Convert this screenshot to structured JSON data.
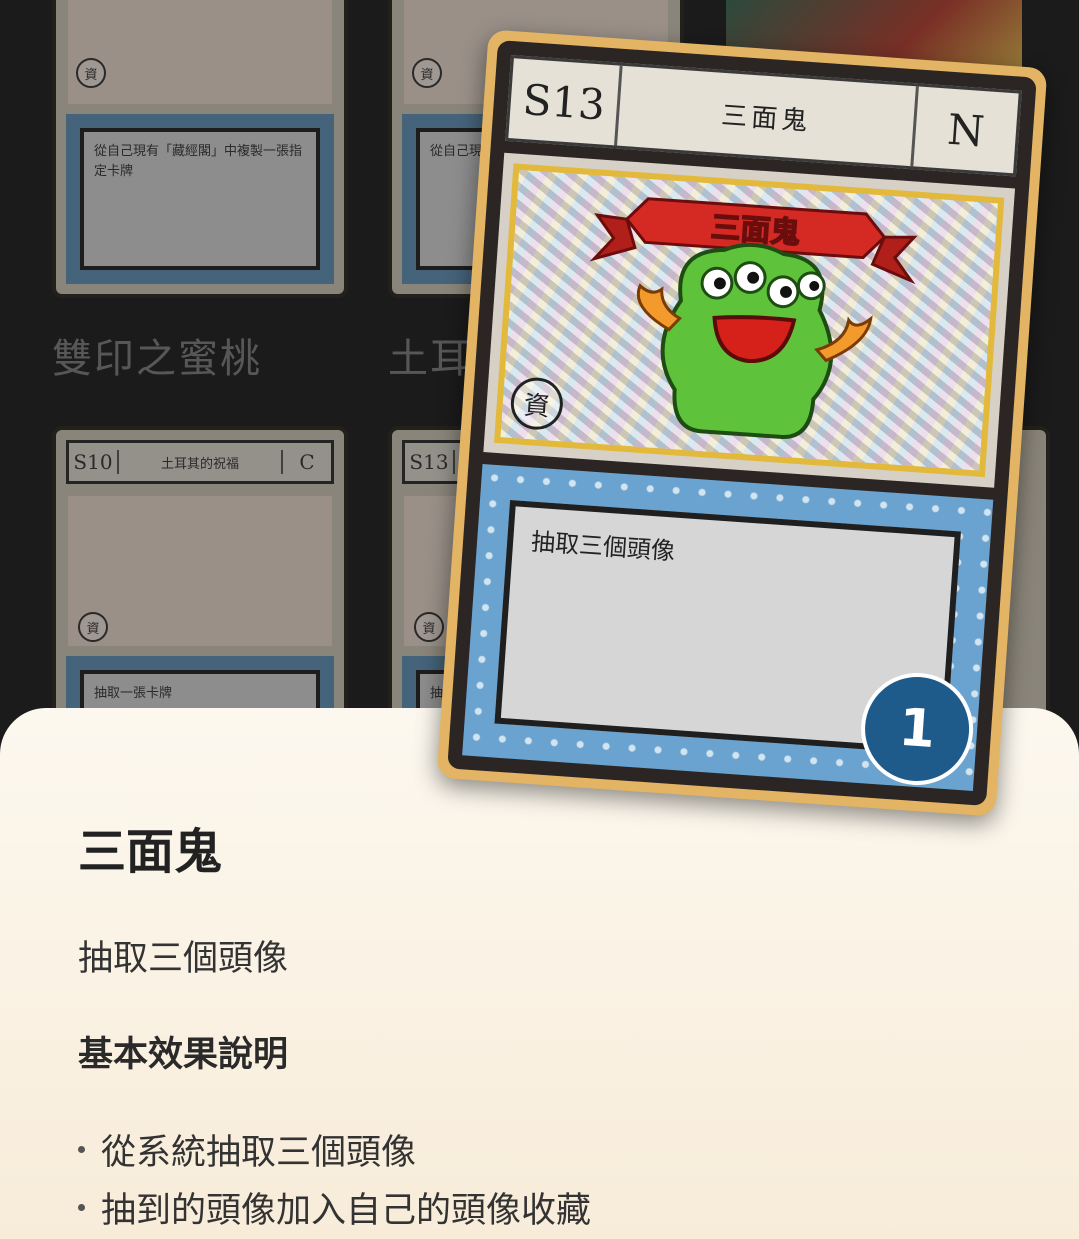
{
  "background": {
    "cards": [
      {
        "title": "雙印之蜜桃",
        "text": "從自己現有「藏經閣」中複製一張指定卡牌",
        "stamp": "資"
      },
      {
        "title": "土耳",
        "text": "從自己現有「藏經閣」中複製一張",
        "stamp": "資"
      },
      {
        "code": "S10",
        "name": "土耳其的祝福",
        "rarity": "C",
        "text": "抽取一張卡牌",
        "stamp": "資"
      },
      {
        "code": "S13",
        "text": "抽",
        "stamp": "資"
      }
    ]
  },
  "featured_card": {
    "code": "S13",
    "name": "三面鬼",
    "rarity": "N",
    "banner": "三面鬼",
    "stamp": "資",
    "effect_text": "抽取三個頭像",
    "count": "1",
    "colors": {
      "frame": "#e3b464",
      "panel": "#6aa3cf",
      "badge": "#1e5a8a"
    }
  },
  "sheet": {
    "title": "三面鬼",
    "description": "抽取三個頭像",
    "section_heading": "基本效果說明",
    "bullets": [
      "從系統抽取三個頭像",
      "抽到的頭像加入自己的頭像收藏"
    ]
  }
}
